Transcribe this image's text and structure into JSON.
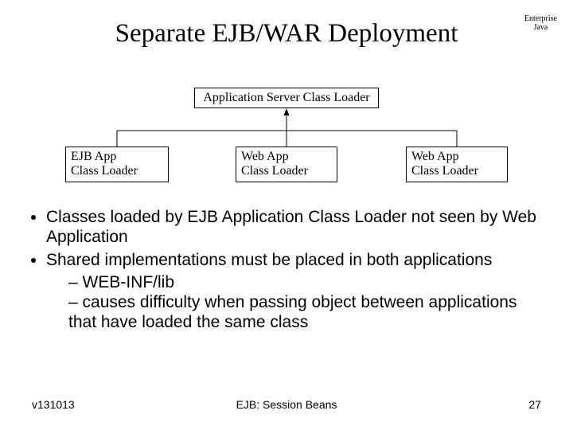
{
  "header": {
    "title": "Separate EJB/WAR Deployment",
    "tagline": "Enterprise\nJava"
  },
  "diagram": {
    "top": "Application Server Class Loader",
    "left": "EJB App\nClass Loader",
    "center": "Web App\nClass Loader",
    "right": "Web App\nClass Loader"
  },
  "bullets": {
    "b1": "Classes loaded by EJB Application Class Loader not seen by Web Application",
    "b2": "Shared implementations must be placed in both applications",
    "b2a": "WEB-INF/lib",
    "b2b": "causes difficulty when passing object between applications that have loaded the same class"
  },
  "footer": {
    "left": "v131013",
    "center": "EJB: Session Beans",
    "right": "27"
  }
}
